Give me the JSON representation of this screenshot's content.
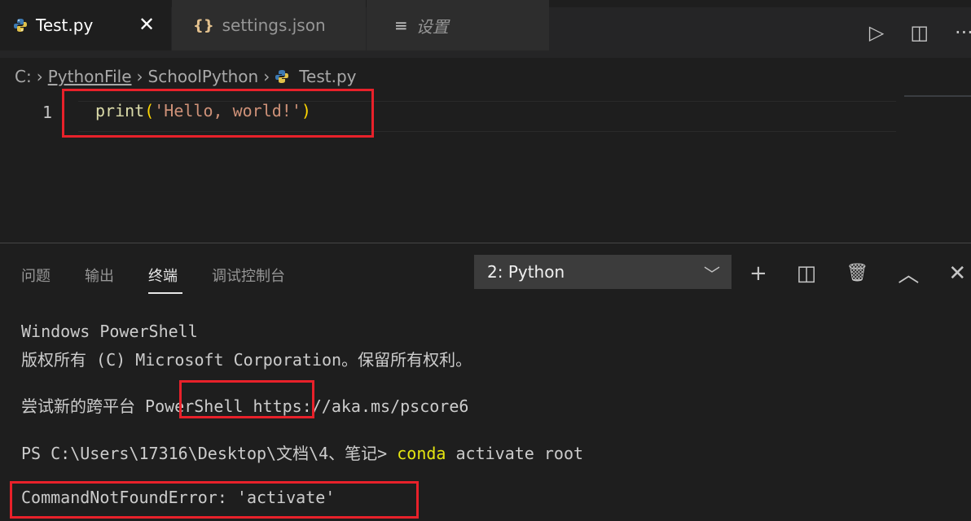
{
  "tabs": [
    {
      "icon": "python-icon",
      "label": "Test.py",
      "active": true,
      "close": "✕"
    },
    {
      "icon": "json-icon",
      "icon_text": "{}",
      "label": "settings.json"
    },
    {
      "icon": "settings-list-icon",
      "icon_text": "≡",
      "label": "设置"
    }
  ],
  "tab_actions": [
    {
      "name": "run-icon",
      "glyph": "▷"
    },
    {
      "name": "split-editor-icon",
      "glyph": "◫"
    },
    {
      "name": "more-actions-icon",
      "glyph": "···"
    }
  ],
  "breadcrumb": {
    "drive": "C:",
    "sep": "›",
    "folder1": "PythonFile",
    "folder2": "SchoolPython",
    "file": "Test.py"
  },
  "editor": {
    "line_number": "1",
    "code_fn": "print",
    "code_open": "(",
    "code_str": "'Hello, world!'",
    "code_close": ")"
  },
  "panel": {
    "tabs": [
      "问题",
      "输出",
      "终端",
      "调试控制台"
    ],
    "active_tab": "终端",
    "terminal_select": "2: Python",
    "select_chevron": "﹀",
    "actions": [
      {
        "name": "new-terminal-icon",
        "glyph": "+"
      },
      {
        "name": "split-terminal-icon",
        "glyph": "◫"
      },
      {
        "name": "trash-icon",
        "glyph": "🗑"
      },
      {
        "name": "maximize-panel-icon",
        "glyph": "︿"
      },
      {
        "name": "close-panel-icon",
        "glyph": "✕"
      }
    ]
  },
  "terminal": {
    "line1": "Windows PowerShell",
    "line2": "版权所有 (C) Microsoft Corporation。保留所有权利。",
    "line3_prefix": "尝试新的跨平台 ",
    "line3_highlight": "PowerShell",
    "line3_suffix": " https://aka.ms/pscore6",
    "prompt": "PS C:\\Users\\17316\\Desktop\\文档\\4、笔记> ",
    "cmd_conda": "conda",
    "cmd_rest": " activate root",
    "error": "CommandNotFoundError: 'activate'"
  },
  "colors": {
    "highlight_box": "#e8212a",
    "editor_bg": "#1e1e1e",
    "tabbar_bg": "#252526"
  }
}
